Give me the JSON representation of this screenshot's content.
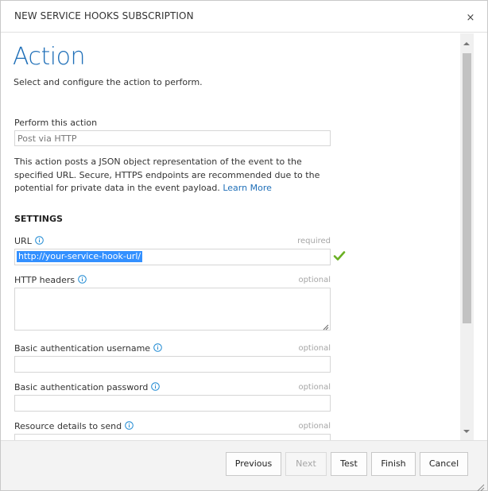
{
  "dialog": {
    "title": "NEW SERVICE HOOKS SUBSCRIPTION",
    "close_glyph": "×"
  },
  "page": {
    "heading": "Action",
    "subheading": "Select and configure the action to perform."
  },
  "action": {
    "label": "Perform this action",
    "value": "Post via HTTP",
    "description": "This action posts a JSON object representation of the event to the specified URL. Secure, HTTPS endpoints are recommended due to the potential for private data in the event payload.",
    "learn_more": "Learn More"
  },
  "settings": {
    "title": "SETTINGS",
    "url": {
      "label": "URL",
      "hint": "required",
      "value": "http://your-service-hook-url/",
      "valid_icon": "checkmark-icon"
    },
    "headers": {
      "label": "HTTP headers",
      "hint": "optional",
      "value": ""
    },
    "username": {
      "label": "Basic authentication username",
      "hint": "optional",
      "value": ""
    },
    "password": {
      "label": "Basic authentication password",
      "hint": "optional",
      "value": ""
    },
    "resource": {
      "label": "Resource details to send",
      "hint": "optional",
      "value": ""
    }
  },
  "footer": {
    "previous": "Previous",
    "next": "Next",
    "test": "Test",
    "finish": "Finish",
    "cancel": "Cancel"
  },
  "colors": {
    "accent": "#1f6fb8",
    "selection": "#3390ff",
    "valid": "#6ab023",
    "hint": "#a6a6a6"
  }
}
